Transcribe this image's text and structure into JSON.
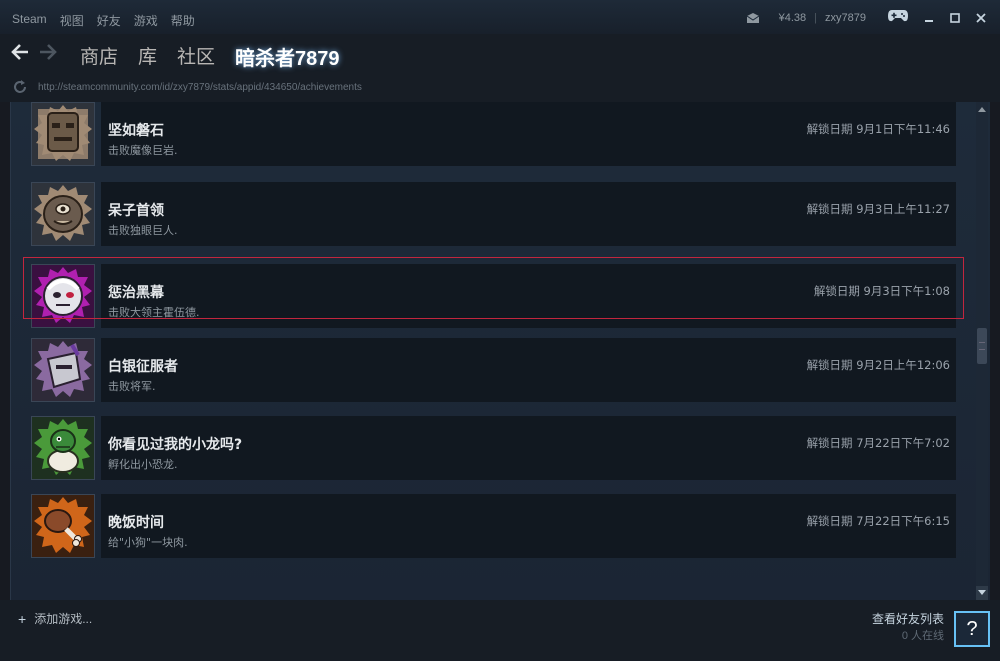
{
  "menu": [
    "Steam",
    "视图",
    "好友",
    "游戏",
    "帮助"
  ],
  "account": {
    "balance": "¥4.38",
    "username": "zxy7879"
  },
  "nav": {
    "links": [
      "商店",
      "库",
      "社区"
    ],
    "user": "暗杀者7879"
  },
  "url": "http://steamcommunity.com/id/zxy7879/stats/appid/434650/achievements",
  "achievements": [
    {
      "title": "坚如磐石",
      "desc": "击败魔像巨岩.",
      "date": "解锁日期 9月1日下午11:46",
      "icon": "stone-golem-icon",
      "icon_bg": "#8d7b6a"
    },
    {
      "title": "呆子首领",
      "desc": "击败独眼巨人.",
      "date": "解锁日期 9月3日上午11:27",
      "icon": "cyclops-icon",
      "icon_bg": "#8d7b6a"
    },
    {
      "title": "惩治黑幕",
      "desc": "击败大领主霍伍德.",
      "date": "解锁日期 9月3日下午1:08",
      "icon": "overlord-icon",
      "icon_bg": "#b020b0"
    },
    {
      "title": "白银征服者",
      "desc": "击败将军.",
      "date": "解锁日期 9月2日上午12:06",
      "icon": "armored-general-icon",
      "icon_bg": "#8a6aa0"
    },
    {
      "title": "你看见过我的小龙吗?",
      "desc": "孵化出小恐龙.",
      "date": "解锁日期 7月22日下午7:02",
      "icon": "baby-dragon-icon",
      "icon_bg": "#4a9a3a"
    },
    {
      "title": "晚饭时间",
      "desc": "给\"小狗\"一块肉.",
      "date": "解锁日期 7月22日下午6:15",
      "icon": "meat-leg-icon",
      "icon_bg": "#d0661a"
    }
  ],
  "bottom": {
    "add_game": "添加游戏...",
    "friends_label": "查看好友列表",
    "friends_count": "0 人在线",
    "help": "?"
  },
  "colors": {
    "highlight_border": "#c2263e",
    "help_border": "#67c1f5"
  }
}
